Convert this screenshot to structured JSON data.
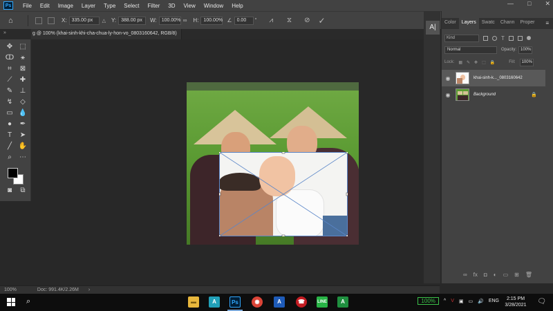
{
  "app": {
    "logo": "Ps",
    "menu": [
      "File",
      "Edit",
      "Image",
      "Layer",
      "Type",
      "Select",
      "Filter",
      "3D",
      "View",
      "Window",
      "Help"
    ],
    "window_controls": [
      "—",
      "□",
      "✕"
    ]
  },
  "options_bar": {
    "x_label": "X:",
    "x_value": "335.00 px",
    "y_label": "Y:",
    "y_value": "388.00 px",
    "w_label": "W:",
    "w_value": "100.00%",
    "h_label": "H:",
    "h_value": "100.00%",
    "angle_value": "0.00",
    "angle_unit": "°"
  },
  "document": {
    "tab_title": "g @ 100% (khai-sinh-khi-cha-chua-ly-hon-vo_0803160642, RGB/8)",
    "zoom": "100%",
    "doc_info": "Doc: 991.4K/2.26M"
  },
  "panels": {
    "tabs": [
      "Color",
      "Layers",
      "Swatc",
      "Chann",
      "Proper"
    ],
    "active_tab": "Layers",
    "filter_placeholder": "Kind",
    "blend_mode": "Normal",
    "opacity_label": "Opacity:",
    "opacity_value": "100%",
    "lock_label": "Lock:",
    "fill_label": "Fill:",
    "fill_value": "100%",
    "layers": [
      {
        "name": "khai-sinh-k..._0803160642",
        "selected": true,
        "italic": false
      },
      {
        "name": "Background",
        "selected": false,
        "italic": true,
        "locked": true
      }
    ]
  },
  "taskbar": {
    "battery": "100%",
    "language": "ENG",
    "time": "2:15 PM",
    "date": "3/28/2021"
  },
  "colors": {
    "accent": "#31a8ff",
    "selected_layer": "#595959",
    "transform_box": "#5a86c8",
    "battery": "#3cc24a"
  }
}
